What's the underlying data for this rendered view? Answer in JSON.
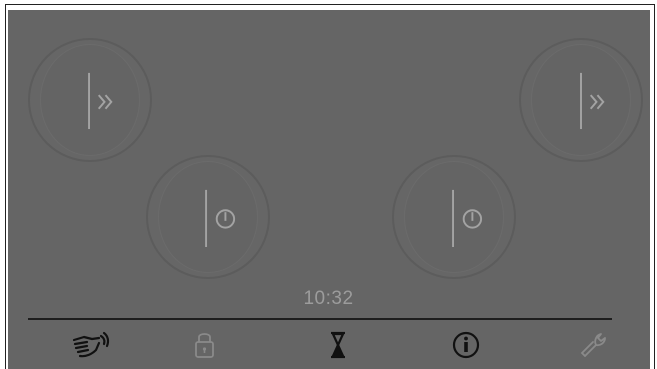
{
  "status": {
    "clock": "10:32"
  },
  "cooktop": {
    "zones": [
      {
        "id": "rear-left",
        "icon": "boost-icon",
        "state": "boost"
      },
      {
        "id": "front-left",
        "icon": "power-icon",
        "state": "off"
      },
      {
        "id": "front-right",
        "icon": "power-icon",
        "state": "off"
      },
      {
        "id": "rear-right",
        "icon": "boost-icon",
        "state": "boost"
      }
    ]
  },
  "toolbar": {
    "items": [
      {
        "name": "wipe-protection",
        "icon": "wipe-hand-icon",
        "color": "#111111"
      },
      {
        "name": "child-lock",
        "icon": "lock-icon",
        "color": "#8a8a8a"
      },
      {
        "name": "timer",
        "icon": "hourglass-icon",
        "color": "#111111"
      },
      {
        "name": "info",
        "icon": "info-icon",
        "color": "#111111"
      },
      {
        "name": "settings",
        "icon": "wrench-icon",
        "color": "#8a8a8a"
      }
    ]
  },
  "colors": {
    "panel": "#656565",
    "zone_line": "#9a9a9a",
    "clock_text": "#9c9c9c",
    "divider": "#1e1e1e"
  }
}
